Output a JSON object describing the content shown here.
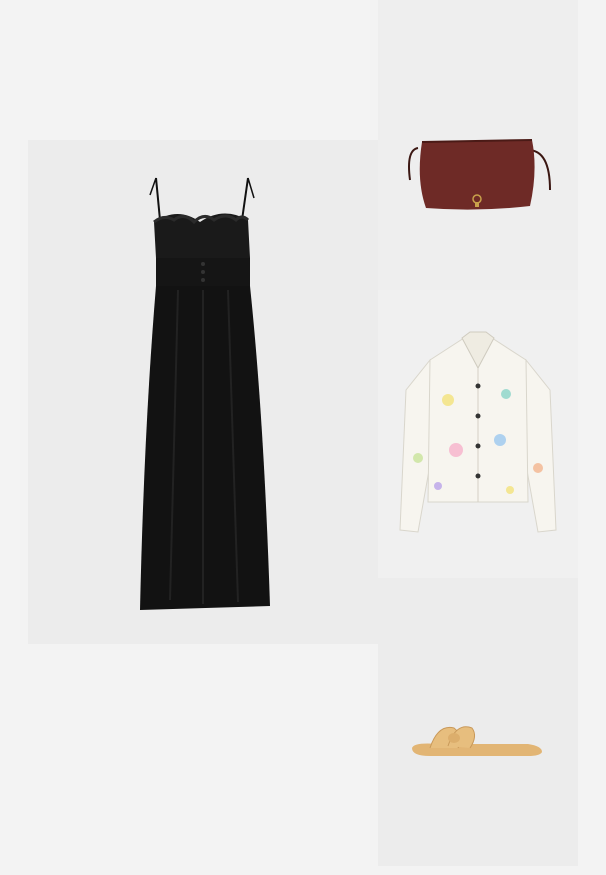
{
  "outfit": {
    "items": [
      {
        "id": "dress",
        "kind": "black-maxi-dress-image",
        "color": "#141414"
      },
      {
        "id": "bag",
        "kind": "burgundy-shoulder-bag-image",
        "color": "#6e2a26"
      },
      {
        "id": "jacket",
        "kind": "floral-denim-jacket-image",
        "color": "#f7f5ef"
      },
      {
        "id": "sandal",
        "kind": "tan-knot-slide-sandal-image",
        "color": "#e7be7e"
      }
    ]
  }
}
